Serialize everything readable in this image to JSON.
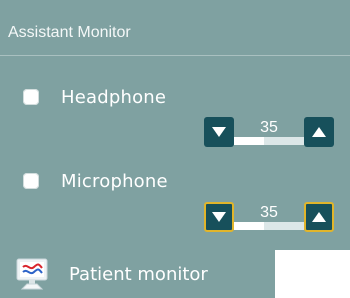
{
  "panel": {
    "title": "Assistant Monitor",
    "background": "#7fa1a1"
  },
  "headphone": {
    "label": "Headphone",
    "checked": false,
    "level": "35"
  },
  "microphone": {
    "label": "Microphone",
    "checked": false,
    "level": "35"
  },
  "patient_monitor": {
    "label": "Patient monitor",
    "icon": "monitor-icon"
  },
  "colors": {
    "button_dark": "#17505b",
    "focus_border": "#e1b52b"
  }
}
